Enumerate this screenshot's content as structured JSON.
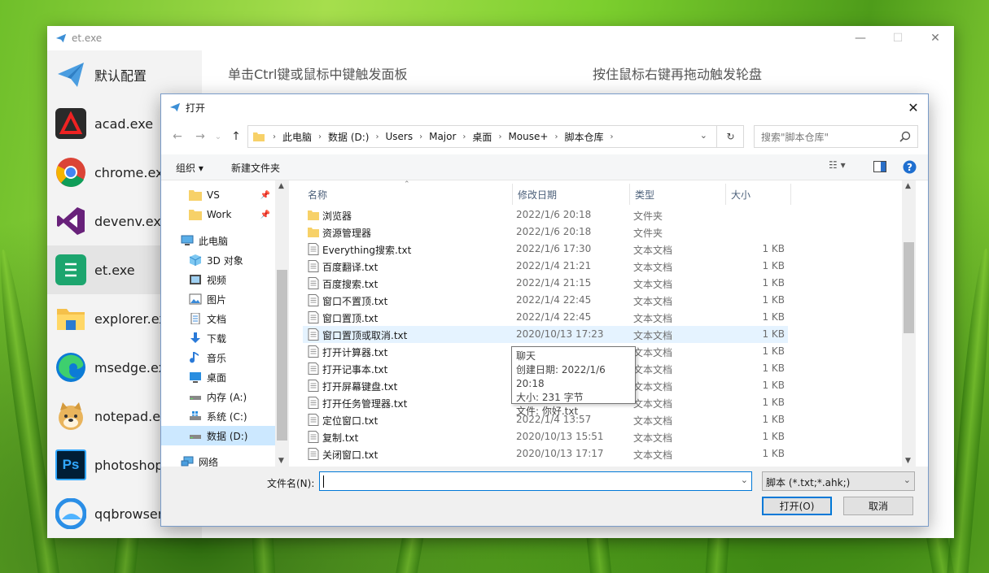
{
  "app": {
    "title": "et.exe",
    "minimize": "—",
    "maximize": "☐",
    "close": "✕",
    "hint_left": "单击Ctrl键或鼠标中键触发面板",
    "hint_right": "按住鼠标右键再拖动触发轮盘",
    "items": [
      {
        "label": "默认配置",
        "icon": "paper-plane-icon"
      },
      {
        "label": "acad.exe",
        "icon": "autocad-icon"
      },
      {
        "label": "chrome.exe",
        "icon": "chrome-icon"
      },
      {
        "label": "devenv.exe",
        "icon": "visual-studio-icon"
      },
      {
        "label": "et.exe",
        "icon": "et-icon"
      },
      {
        "label": "explorer.exe",
        "icon": "folder-icon"
      },
      {
        "label": "msedge.exe",
        "icon": "edge-icon"
      },
      {
        "label": "notepad.exe",
        "icon": "doge-icon"
      },
      {
        "label": "photoshop.exe",
        "icon": "photoshop-icon"
      },
      {
        "label": "qqbrowser.exe",
        "icon": "qqbrowser-icon"
      }
    ]
  },
  "dialog": {
    "title": "打开",
    "close": "✕",
    "breadcrumb": [
      "此电脑",
      "数据 (D:)",
      "Users",
      "Major",
      "桌面",
      "Mouse+",
      "脚本仓库"
    ],
    "search_placeholder": "搜索\"脚本仓库\"",
    "toolbar": {
      "organize": "组织 ▾",
      "new_folder": "新建文件夹"
    },
    "nav": [
      {
        "label": "VS",
        "icon": "folder-icon",
        "pinned": true
      },
      {
        "label": "Work",
        "icon": "folder-icon",
        "pinned": true
      },
      {
        "label": "此电脑",
        "icon": "computer-icon"
      },
      {
        "label": "3D 对象",
        "icon": "3d-objects-icon"
      },
      {
        "label": "视频",
        "icon": "video-icon"
      },
      {
        "label": "图片",
        "icon": "pictures-icon"
      },
      {
        "label": "文档",
        "icon": "documents-icon"
      },
      {
        "label": "下载",
        "icon": "download-icon"
      },
      {
        "label": "音乐",
        "icon": "music-icon"
      },
      {
        "label": "桌面",
        "icon": "desktop-icon"
      },
      {
        "label": "内存 (A:)",
        "icon": "drive-icon"
      },
      {
        "label": "系统 (C:)",
        "icon": "drive-icon"
      },
      {
        "label": "数据 (D:)",
        "icon": "drive-icon",
        "selected": true
      },
      {
        "label": "网络",
        "icon": "network-icon"
      }
    ],
    "columns": {
      "name": "名称",
      "date": "修改日期",
      "type": "类型",
      "size": "大小"
    },
    "files": [
      {
        "name": "浏览器",
        "date": "2022/1/6 20:18",
        "type": "文件夹",
        "size": "",
        "kind": "folder"
      },
      {
        "name": "资源管理器",
        "date": "2022/1/6 20:18",
        "type": "文件夹",
        "size": "",
        "kind": "folder"
      },
      {
        "name": "Everything搜索.txt",
        "date": "2022/1/6 17:30",
        "type": "文本文档",
        "size": "1 KB",
        "kind": "txt"
      },
      {
        "name": "百度翻译.txt",
        "date": "2022/1/4 21:21",
        "type": "文本文档",
        "size": "1 KB",
        "kind": "txt"
      },
      {
        "name": "百度搜索.txt",
        "date": "2022/1/4 21:15",
        "type": "文本文档",
        "size": "1 KB",
        "kind": "txt"
      },
      {
        "name": "窗口不置顶.txt",
        "date": "2022/1/4 22:45",
        "type": "文本文档",
        "size": "1 KB",
        "kind": "txt"
      },
      {
        "name": "窗口置顶.txt",
        "date": "2022/1/4 22:45",
        "type": "文本文档",
        "size": "1 KB",
        "kind": "txt"
      },
      {
        "name": "窗口置顶或取消.txt",
        "date": "2020/10/13 17:23",
        "type": "文本文档",
        "size": "1 KB",
        "kind": "txt",
        "hover": true
      },
      {
        "name": "打开计算器.txt",
        "date": "",
        "type": "文本文档",
        "size": "1 KB",
        "kind": "txt"
      },
      {
        "name": "打开记事本.txt",
        "date": "",
        "type": "文本文档",
        "size": "1 KB",
        "kind": "txt"
      },
      {
        "name": "打开屏幕键盘.txt",
        "date": "",
        "type": "文本文档",
        "size": "1 KB",
        "kind": "txt"
      },
      {
        "name": "打开任务管理器.txt",
        "date": "",
        "type": "文本文档",
        "size": "1 KB",
        "kind": "txt"
      },
      {
        "name": "定位窗口.txt",
        "date": "2022/1/4 13:57",
        "type": "文本文档",
        "size": "1 KB",
        "kind": "txt"
      },
      {
        "name": "复制.txt",
        "date": "2020/10/13 15:51",
        "type": "文本文档",
        "size": "1 KB",
        "kind": "txt"
      },
      {
        "name": "关闭窗口.txt",
        "date": "2020/10/13 17:17",
        "type": "文本文档",
        "size": "1 KB",
        "kind": "txt"
      }
    ],
    "tooltip": [
      "聊天",
      "创建日期: 2022/1/6 20:18",
      "大小: 231 字节",
      "文件: 你好.txt"
    ],
    "filename_label": "文件名(N):",
    "filename_value": "",
    "filter": "脚本 (*.txt;*.ahk;)",
    "open_button": "打开(O)",
    "cancel_button": "取消"
  },
  "colors": {
    "accent": "#0078d7",
    "selection": "#cce8ff",
    "hover": "#e5f3ff"
  }
}
